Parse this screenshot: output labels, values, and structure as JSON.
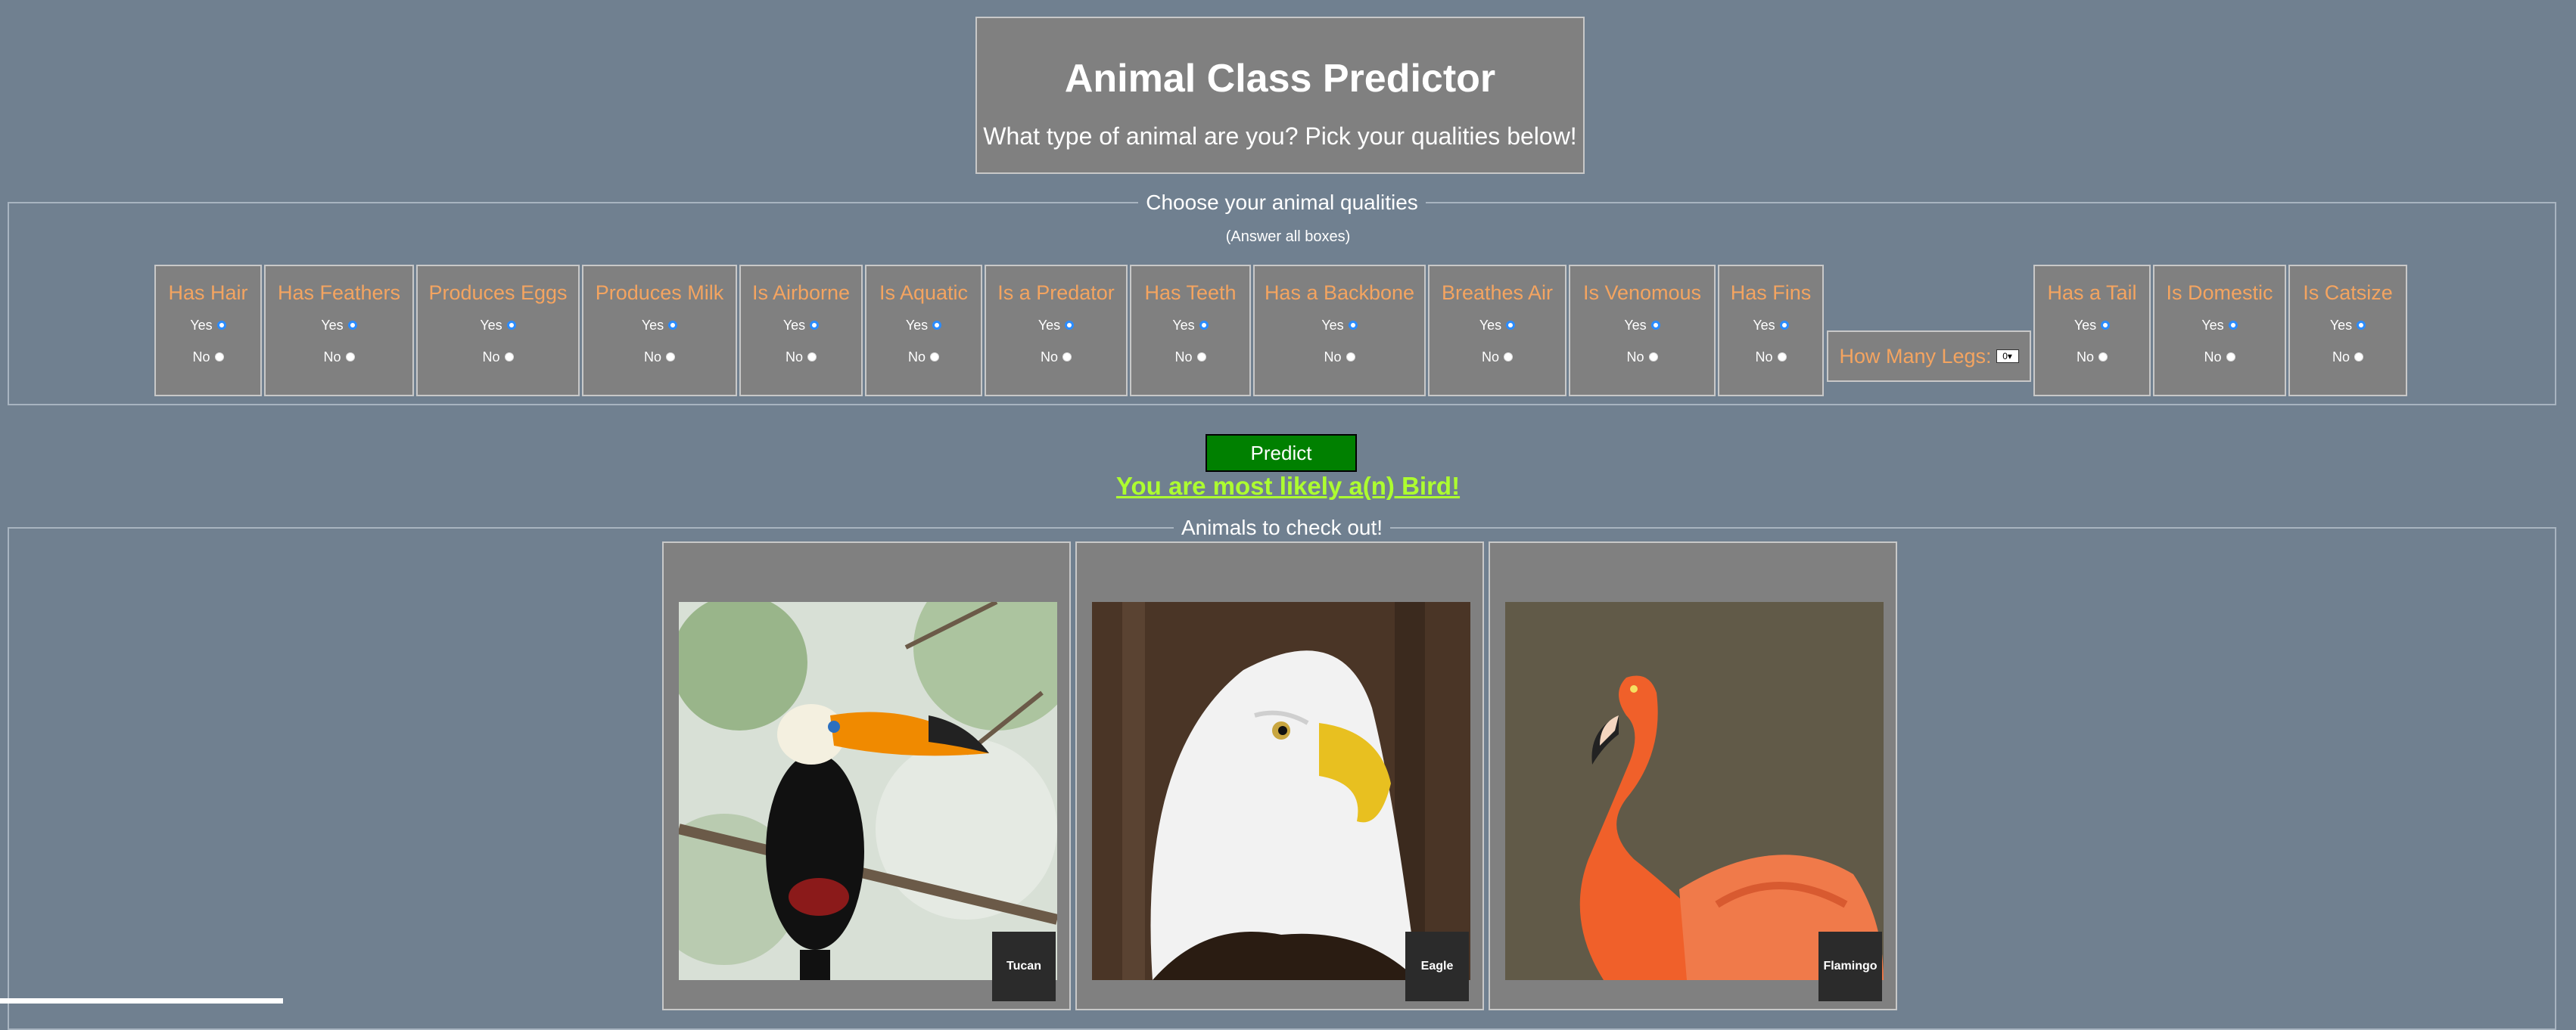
{
  "header": {
    "title": "Animal Class Predictor",
    "subtitle": "What type of animal are you? Pick your qualities below!"
  },
  "qualities": {
    "legend": "Choose your animal qualities",
    "note": "(Answer all boxes)",
    "yes_label": "Yes",
    "no_label": "No",
    "items": [
      {
        "label": "Has Hair"
      },
      {
        "label": "Has Feathers"
      },
      {
        "label": "Produces Eggs"
      },
      {
        "label": "Produces Milk"
      },
      {
        "label": "Is Airborne"
      },
      {
        "label": "Is Aquatic"
      },
      {
        "label": "Is a Predator"
      },
      {
        "label": "Has Teeth"
      },
      {
        "label": "Has a Backbone"
      },
      {
        "label": "Breathes Air"
      },
      {
        "label": "Is Venomous"
      },
      {
        "label": "Has Fins"
      },
      {
        "label": "Has a Tail"
      },
      {
        "label": "Is Domestic"
      },
      {
        "label": "Is Catsize"
      }
    ],
    "legs": {
      "label": "How Many Legs:",
      "value": "0"
    }
  },
  "predict_label": "Predict",
  "result_text": "You are most likely a(n) Bird!",
  "animals": {
    "legend": "Animals to check out!",
    "cards": [
      {
        "name": "Tucan"
      },
      {
        "name": "Eagle"
      },
      {
        "name": "Flamingo"
      }
    ]
  },
  "colors": {
    "background": "#708090",
    "panel": "#808080",
    "quality_label": "#f4a460",
    "predict_button": "#008000",
    "result": "#adff2f"
  }
}
